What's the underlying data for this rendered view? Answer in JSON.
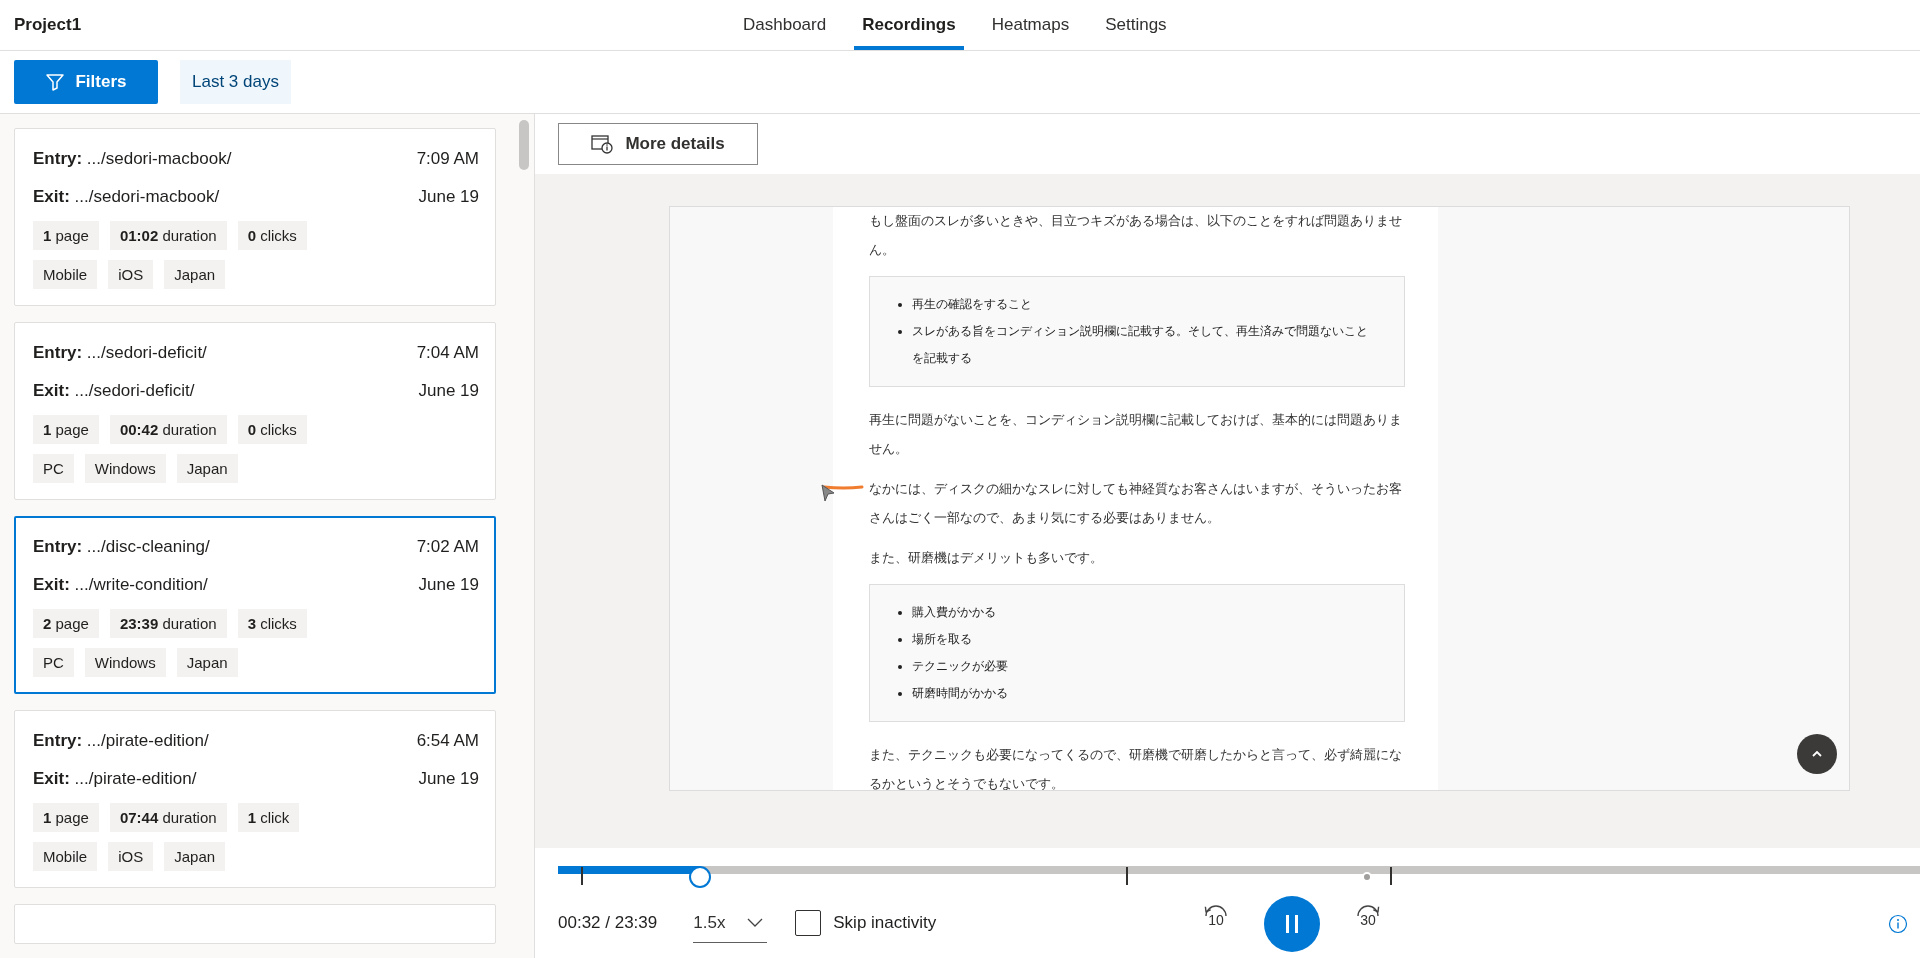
{
  "header": {
    "project": "Project1",
    "tabs": [
      {
        "label": "Dashboard",
        "selected": false
      },
      {
        "label": "Recordings",
        "selected": true
      },
      {
        "label": "Heatmaps",
        "selected": false
      },
      {
        "label": "Settings",
        "selected": false
      }
    ]
  },
  "toolbar": {
    "filters": "Filters",
    "range": "Last 3 days"
  },
  "recordings": [
    {
      "entry": "**Entry:** .../sedori-macbook/",
      "time": "7:09 AM",
      "exit": "**Exit:** .../sedori-macbook/",
      "date": "June 19",
      "stats": [
        "**1** page",
        "**01:02** duration",
        "**0** clicks"
      ],
      "tags": [
        "Mobile",
        "iOS",
        "Japan"
      ],
      "selected": false
    },
    {
      "entry": "**Entry:** .../sedori-deficit/",
      "time": "7:04 AM",
      "exit": "**Exit:** .../sedori-deficit/",
      "date": "June 19",
      "stats": [
        "**1** page",
        "**00:42** duration",
        "**0** clicks"
      ],
      "tags": [
        "PC",
        "Windows",
        "Japan"
      ],
      "selected": false
    },
    {
      "entry": "**Entry:** .../disc-cleaning/",
      "time": "7:02 AM",
      "exit": "**Exit:** .../write-condition/",
      "date": "June 19",
      "stats": [
        "**2** page",
        "**23:39** duration",
        "**3** clicks"
      ],
      "tags": [
        "PC",
        "Windows",
        "Japan"
      ],
      "selected": true
    },
    {
      "entry": "**Entry:** .../pirate-edition/",
      "time": "6:54 AM",
      "exit": "**Exit:** .../pirate-edition/",
      "date": "June 19",
      "stats": [
        "**1** page",
        "**07:44** duration",
        "**1** click"
      ],
      "tags": [
        "Mobile",
        "iOS",
        "Japan"
      ],
      "selected": false
    }
  ],
  "details_button": "More details",
  "replay": {
    "blocks": [
      {
        "kind": "paragraph",
        "text": "もし盤面のスレが多いときや、目立つキズがある場合は、以下のことをすれば問題ありません。"
      },
      {
        "kind": "list",
        "items": [
          "再生の確認をすること",
          "スレがある旨をコンディション説明欄に記載する。そして、再生済みで問題ないことを記載する"
        ]
      },
      {
        "kind": "paragraph",
        "text": "再生に問題がないことを、コンディション説明欄に記載しておけば、基本的には問題ありません。"
      },
      {
        "kind": "paragraph",
        "text": "なかには、ディスクの細かなスレに対しても神経質なお客さんはいますが、そういったお客さんはごく一部なので、あまり気にする必要はありません。"
      },
      {
        "kind": "paragraph",
        "text": "また、研磨機はデメリットも多いです。"
      },
      {
        "kind": "list",
        "items": [
          "購入費がかかる",
          "場所を取る",
          "テクニックが必要",
          "研磨時間がかかる"
        ]
      },
      {
        "kind": "paragraph",
        "text": "また、テクニックも必要になってくるので、研磨機で研磨したからと言って、必ず綺麗になるかというとそうでもないです。"
      }
    ]
  },
  "player": {
    "level": 0.104,
    "time": "00:32 / 23:39",
    "speed": "1.5x",
    "skip_inactivity": {
      "label": "Skip inactivity",
      "checked": false
    },
    "rewind": "10",
    "forward": "30",
    "playing": true
  }
}
